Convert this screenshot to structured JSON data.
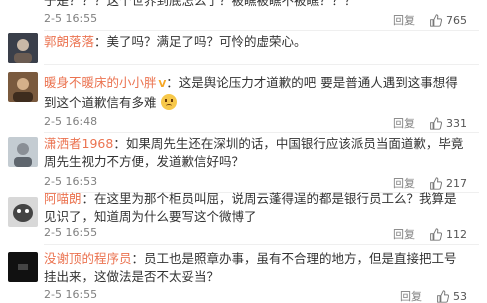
{
  "comments": [
    {
      "text": "于是？？？这个世界到底怎么了？被瞧被瞧不被瞧？？？",
      "time": "2-5 16:55",
      "reply": "回复",
      "likes": "765",
      "avatar_color": "#d9d2c5"
    },
    {
      "user": "郭朗落落",
      "badge": "",
      "text": "美了吗？满足了吗？可怜的虚荣心。",
      "time": "",
      "reply": "回复",
      "likes": "",
      "avatar_color": "#3a3f4a"
    },
    {
      "user": "暖身不暖床的小小胖",
      "badge": "V",
      "text": "这是舆论压力才道歉的吧 要是普通人遇到这事想得到这个道歉信有多难",
      "time": "2-5 16:48",
      "reply": "回复",
      "likes": "331",
      "avatar_color": "#8a6a4a"
    },
    {
      "user": "潇洒者1968",
      "text": "如果周先生还在深圳的话，中国银行应该派员当面道歉，毕竟周先生视力不方便，发道歉信好吗？",
      "time": "2-5 16:53",
      "reply": "回复",
      "likes": "217",
      "avatar_color": "#b8c4cc"
    },
    {
      "user": "阿喵朗",
      "text": "在这里为那个柜员叫屈，说周云蓬得逞的都是银行员工么？我算是见识了，知道周为什么要写这个微博了",
      "time": "2-5 16:55",
      "reply": "回复",
      "likes": "112",
      "avatar_color": "#5a5a5a"
    },
    {
      "user": "没谢顶的程序员",
      "text": "员工也是照章办事，虽有不合理的地方，但是直接把工号挂出来，这做法是否不太妥当？",
      "time": "2-5 16:55",
      "reply": "回复",
      "likes": "53",
      "avatar_color": "#111111"
    }
  ]
}
